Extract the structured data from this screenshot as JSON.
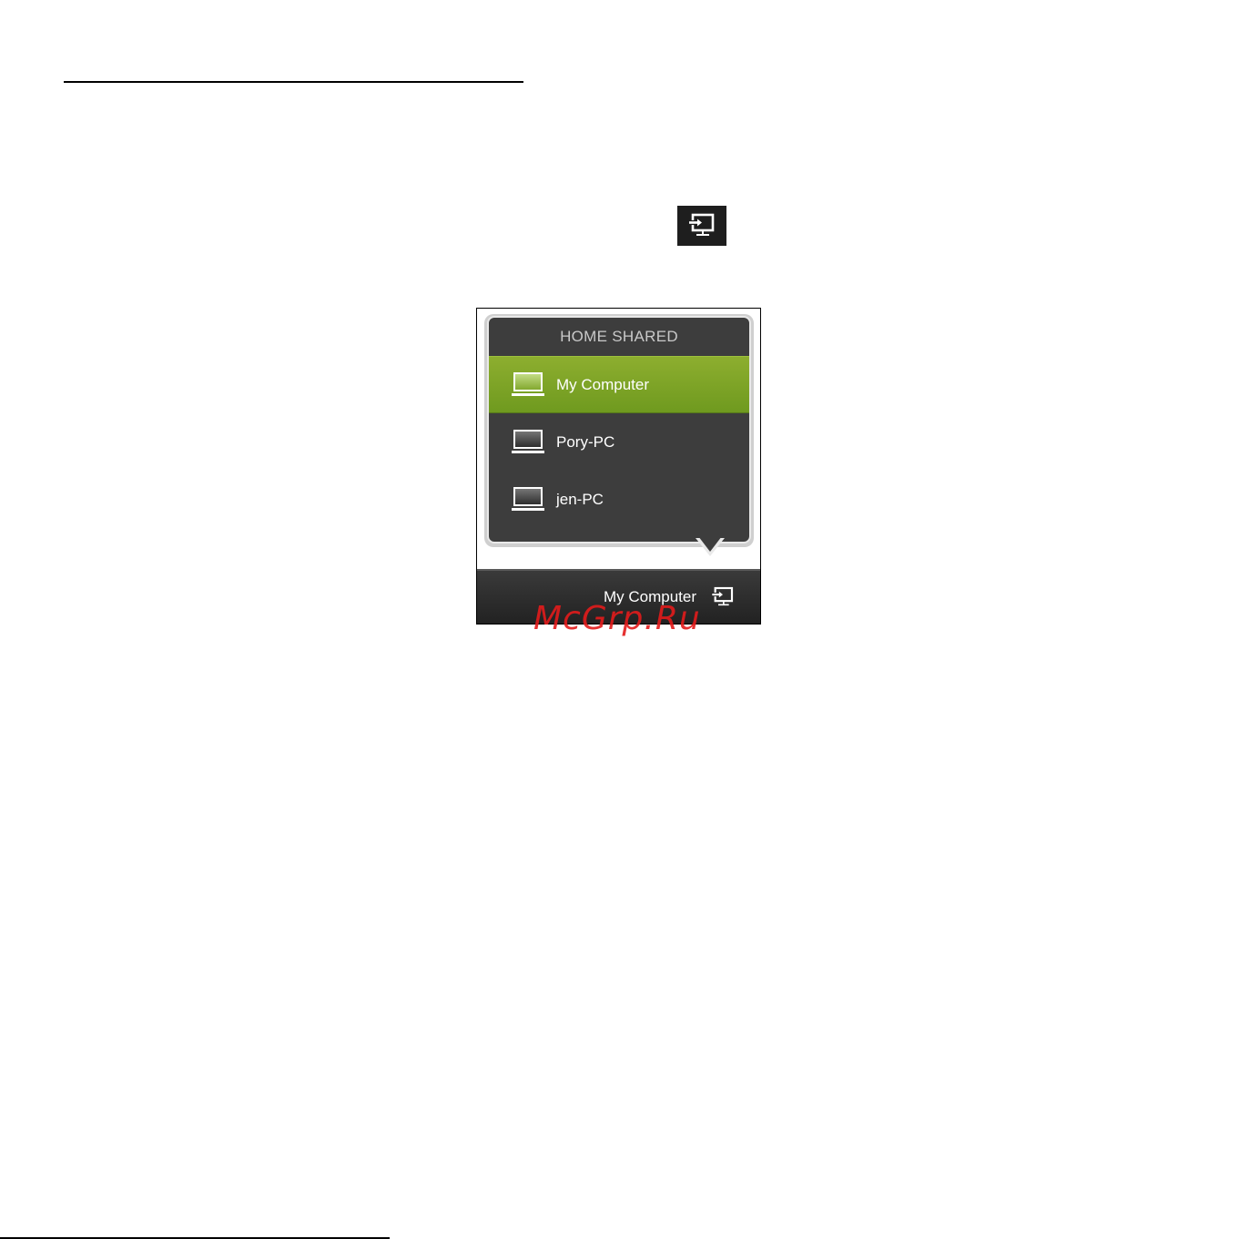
{
  "popup": {
    "header": "HOME SHARED",
    "items": [
      {
        "label": "My Computer",
        "selected": true
      },
      {
        "label": "Pory-PC",
        "selected": false
      },
      {
        "label": "jen-PC",
        "selected": false
      }
    ]
  },
  "bottom_bar": {
    "current_device": "My Computer",
    "icon": "play-to-icon"
  },
  "toolbar_icon": "play-to-icon",
  "watermark": "McGrp.Ru",
  "colors": {
    "selected_accent": "#7ea328",
    "popup_background": "#3d3d3d",
    "bar_background": "#2a2a2a",
    "watermark": "#e31b1b"
  }
}
